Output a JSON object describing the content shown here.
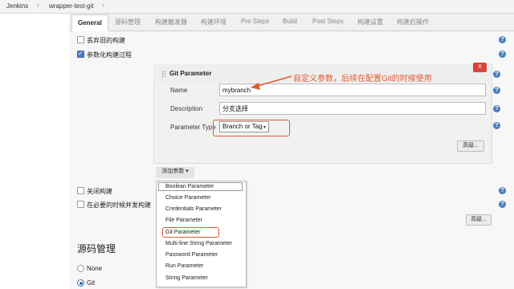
{
  "breadcrumb": {
    "items": [
      "Jenkins",
      "wrapper-test-git"
    ],
    "separator": "›"
  },
  "tabs": [
    "General",
    "源码管理",
    "构建触发器",
    "构建环境",
    "Pre Steps",
    "Build",
    "Post Steps",
    "构建设置",
    "构建后操作"
  ],
  "active_tab": "General",
  "options": {
    "discard_old_builds": "丢弃旧的构建",
    "parameterized": "参数化构建过程",
    "disable_build": "关闭构建",
    "concurrent_build": "在必要的时候并发构建"
  },
  "git_parameter": {
    "title": "Git Parameter",
    "delete_label": "X",
    "name_label": "Name",
    "name_value": "mybranch",
    "description_label": "Description",
    "description_value": "分支选择",
    "type_label": "Parameter Type",
    "type_value": "Branch or Tag",
    "advanced_label": "高级..."
  },
  "annotation": "自定义参数，后续在配置Git的时候使用",
  "add_param_button": "添加参数",
  "add_param_menu": [
    "Boolean Parameter",
    "Choice Parameter",
    "Credentials Parameter",
    "File Parameter",
    "Git Parameter",
    "Multi-line String Parameter",
    "Password Parameter",
    "Run Parameter",
    "String Parameter"
  ],
  "advanced_label_2": "高级...",
  "source_section": {
    "title": "源码管理",
    "options": [
      "None",
      "Git"
    ],
    "selected": "Git"
  },
  "help_glyph": "?",
  "icons": {
    "help": "help-icon",
    "dropdown": "chevron-down-icon",
    "drag": "drag-handle-icon"
  },
  "colors": {
    "annotation": "#e05a32",
    "help": "#4a7fbd",
    "delete": "#d9443a"
  }
}
